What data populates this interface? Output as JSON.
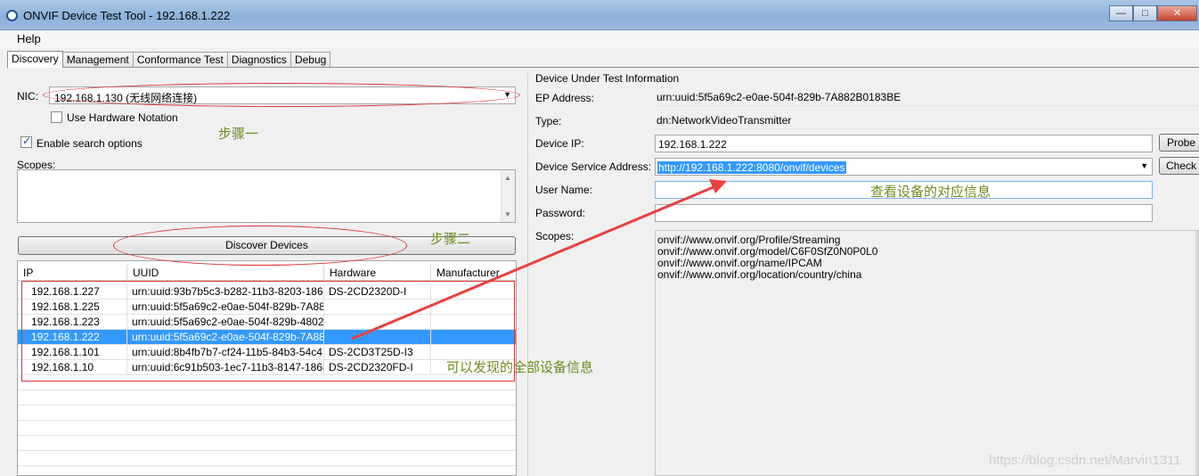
{
  "window": {
    "title": "ONVIF Device Test Tool - 192.168.1.222",
    "minimize_glyph": "—",
    "maximize_glyph": "□",
    "close_glyph": "✕"
  },
  "menu": {
    "help": "Help"
  },
  "tabs": [
    {
      "label": "Discovery",
      "active": true
    },
    {
      "label": "Management",
      "active": false
    },
    {
      "label": "Conformance Test",
      "active": false
    },
    {
      "label": "Diagnostics",
      "active": false
    },
    {
      "label": "Debug",
      "active": false
    }
  ],
  "discovery": {
    "nic_label": "NIC:",
    "nic_value": "192.168.1.130 (无线网络连接)",
    "use_hardware_notation": "Use Hardware Notation",
    "use_hardware_checked": false,
    "enable_search_options": "Enable search options",
    "enable_search_checked": true,
    "scopes_label": "Scopes:",
    "discover_button": "Discover Devices",
    "columns": [
      "IP",
      "UUID",
      "Hardware",
      "Manufacturer"
    ],
    "devices": [
      {
        "ip": "192.168.1.227",
        "uuid": "urn:uuid:93b7b5c3-b282-11b3-8203-1868...",
        "hardware": "DS-2CD2320D-I",
        "manufacturer": ""
      },
      {
        "ip": "192.168.1.225",
        "uuid": "urn:uuid:5f5a69c2-e0ae-504f-829b-7A882...",
        "hardware": "",
        "manufacturer": ""
      },
      {
        "ip": "192.168.1.223",
        "uuid": "urn:uuid:5f5a69c2-e0ae-504f-829b-48022...",
        "hardware": "",
        "manufacturer": ""
      },
      {
        "ip": "192.168.1.222",
        "uuid": "urn:uuid:5f5a69c2-e0ae-504f-829b-7A882...",
        "hardware": "",
        "manufacturer": "",
        "selected": true
      },
      {
        "ip": "192.168.1.101",
        "uuid": "urn:uuid:8b4fb7b7-cf24-11b5-84b3-54c41...",
        "hardware": "DS-2CD3T25D-I3",
        "manufacturer": ""
      },
      {
        "ip": "192.168.1.10",
        "uuid": "urn:uuid:6c91b503-1ec7-11b3-8147-1868...",
        "hardware": "DS-2CD2320FD-I",
        "manufacturer": ""
      }
    ]
  },
  "dut": {
    "section_title": "Device Under Test Information",
    "ep_address_label": "EP Address:",
    "ep_address": "urn:uuid:5f5a69c2-e0ae-504f-829b-7A882B0183BE",
    "type_label": "Type:",
    "type": "dn:NetworkVideoTransmitter",
    "device_ip_label": "Device IP:",
    "device_ip": "192.168.1.222",
    "probe_button": "Probe",
    "service_address_label": "Device Service Address:",
    "service_address": "http://192.168.1.222:8080/onvif/devices",
    "check_button": "Check",
    "username_label": "User Name:",
    "username": "",
    "password_label": "Password:",
    "password": "",
    "scopes_label": "Scopes:",
    "scopes": [
      "onvif://www.onvif.org/Profile/Streaming",
      "onvif://www.onvif.org/model/C6F0SfZ0N0P0L0",
      "onvif://www.onvif.org/name/IPCAM",
      "onvif://www.onvif.org/location/country/china"
    ]
  },
  "annotations": {
    "step1": "步骤一",
    "step2": "步骤二",
    "view_info": "查看设备的对应信息",
    "all_devices": "可以发现的全部设备信息",
    "watermark": "https://blog.csdn.net/Marvin1311",
    "color": "#6b8d1e",
    "markup_color": "#dd3333"
  },
  "colors": {
    "selection": "#3399ff",
    "titlebar": "#9bbbe0"
  }
}
